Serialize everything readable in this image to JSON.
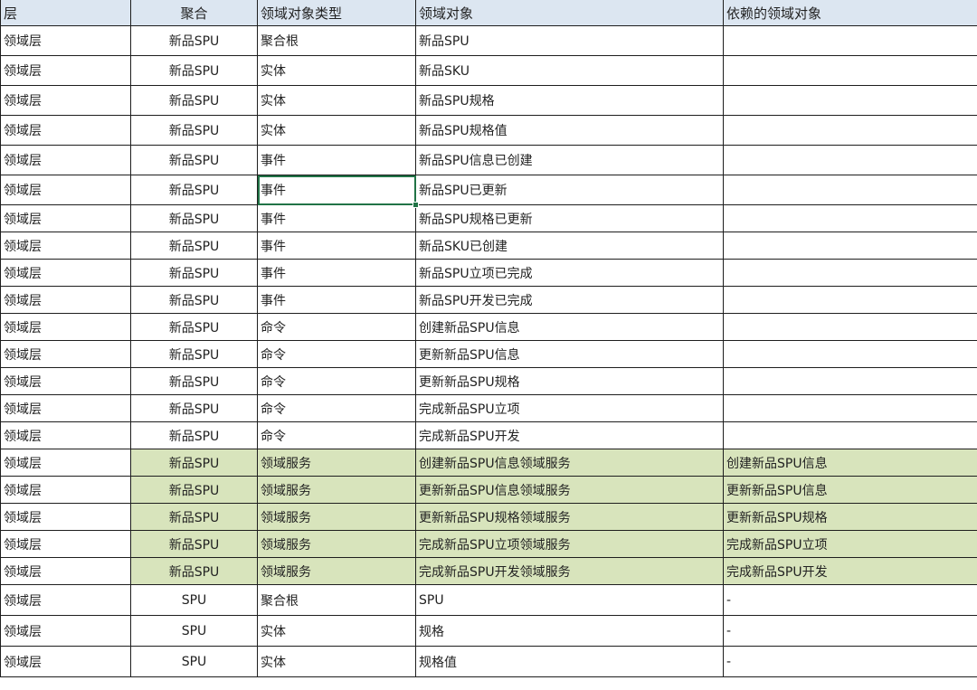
{
  "headers": [
    "层",
    "聚合",
    "领域对象类型",
    "领域对象",
    "依赖的领域对象"
  ],
  "rows": [
    {
      "layer": "领域层",
      "aggregate": "新品SPU",
      "type": "聚合根",
      "object": "新品SPU",
      "depends": ""
    },
    {
      "layer": "领域层",
      "aggregate": "新品SPU",
      "type": "实体",
      "object": "新品SKU",
      "depends": ""
    },
    {
      "layer": "领域层",
      "aggregate": "新品SPU",
      "type": "实体",
      "object": "新品SPU规格",
      "depends": ""
    },
    {
      "layer": "领域层",
      "aggregate": "新品SPU",
      "type": "实体",
      "object": "新品SPU规格值",
      "depends": ""
    },
    {
      "layer": "领域层",
      "aggregate": "新品SPU",
      "type": "事件",
      "object": "新品SPU信息已创建",
      "depends": ""
    },
    {
      "layer": "领域层",
      "aggregate": "新品SPU",
      "type": "事件",
      "object": "新品SPU已更新",
      "depends": ""
    },
    {
      "layer": "领域层",
      "aggregate": "新品SPU",
      "type": "事件",
      "object": "新品SPU规格已更新",
      "depends": ""
    },
    {
      "layer": "领域层",
      "aggregate": "新品SPU",
      "type": "事件",
      "object": "新品SKU已创建",
      "depends": ""
    },
    {
      "layer": "领域层",
      "aggregate": "新品SPU",
      "type": "事件",
      "object": "新品SPU立项已完成",
      "depends": ""
    },
    {
      "layer": "领域层",
      "aggregate": "新品SPU",
      "type": "事件",
      "object": "新品SPU开发已完成",
      "depends": ""
    },
    {
      "layer": "领域层",
      "aggregate": "新品SPU",
      "type": "命令",
      "object": "创建新品SPU信息",
      "depends": ""
    },
    {
      "layer": "领域层",
      "aggregate": "新品SPU",
      "type": "命令",
      "object": "更新新品SPU信息",
      "depends": ""
    },
    {
      "layer": "领域层",
      "aggregate": "新品SPU",
      "type": "命令",
      "object": "更新新品SPU规格",
      "depends": ""
    },
    {
      "layer": "领域层",
      "aggregate": "新品SPU",
      "type": "命令",
      "object": "完成新品SPU立项",
      "depends": ""
    },
    {
      "layer": "领域层",
      "aggregate": "新品SPU",
      "type": "命令",
      "object": "完成新品SPU开发",
      "depends": ""
    },
    {
      "layer": "领域层",
      "aggregate": "新品SPU",
      "type": "领域服务",
      "object": "创建新品SPU信息领域服务",
      "depends": "创建新品SPU信息"
    },
    {
      "layer": "领域层",
      "aggregate": "新品SPU",
      "type": "领域服务",
      "object": "更新新品SPU信息领域服务",
      "depends": "更新新品SPU信息"
    },
    {
      "layer": "领域层",
      "aggregate": "新品SPU",
      "type": "领域服务",
      "object": "更新新品SPU规格领域服务",
      "depends": "更新新品SPU规格"
    },
    {
      "layer": "领域层",
      "aggregate": "新品SPU",
      "type": "领域服务",
      "object": "完成新品SPU立项领域服务",
      "depends": "完成新品SPU立项"
    },
    {
      "layer": "领域层",
      "aggregate": "新品SPU",
      "type": "领域服务",
      "object": "完成新品SPU开发领域服务",
      "depends": "完成新品SPU开发"
    },
    {
      "layer": "领域层",
      "aggregate": "SPU",
      "type": "聚合根",
      "object": "SPU",
      "depends": "-"
    },
    {
      "layer": "领域层",
      "aggregate": "SPU",
      "type": "实体",
      "object": "规格",
      "depends": "-"
    },
    {
      "layer": "领域层",
      "aggregate": "SPU",
      "type": "实体",
      "object": "规格值",
      "depends": "-"
    }
  ],
  "highlight_color": "#d8e4bc",
  "header_color": "#dce6f1",
  "selection_color": "#217346"
}
